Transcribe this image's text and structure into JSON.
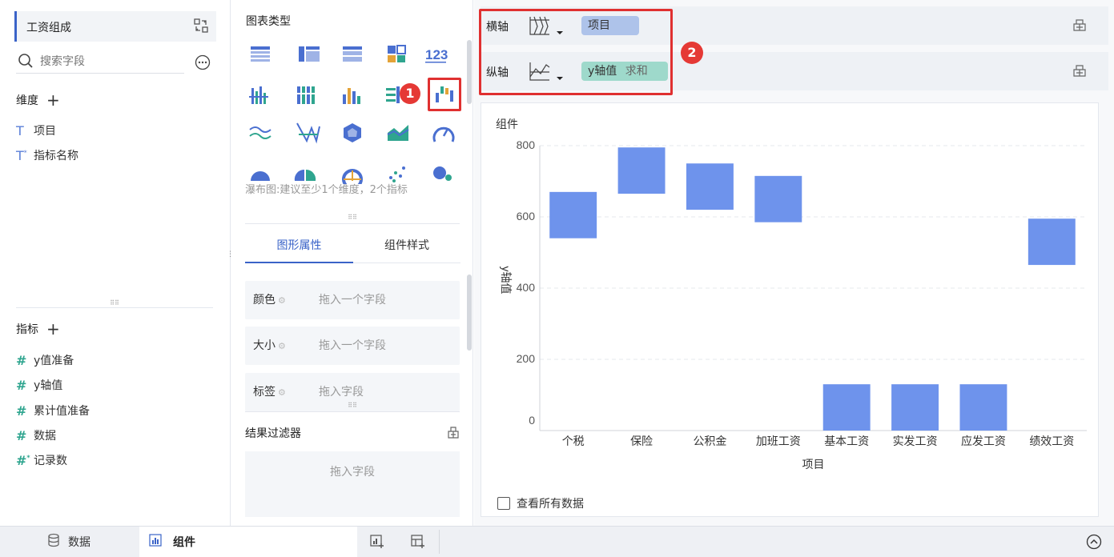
{
  "left": {
    "title": "工资组成",
    "search_placeholder": "搜索字段",
    "dimensions_label": "维度",
    "dimensions": [
      {
        "label": "项目",
        "icon": "text-field-icon"
      },
      {
        "label": "指标名称",
        "icon": "text-field-calc-icon"
      }
    ],
    "metrics_label": "指标",
    "metrics": [
      {
        "label": "y值准备",
        "icon": "hash-icon"
      },
      {
        "label": "y轴值",
        "icon": "hash-icon"
      },
      {
        "label": "累计值准备",
        "icon": "hash-icon"
      },
      {
        "label": "数据",
        "icon": "hash-icon"
      },
      {
        "label": "记录数",
        "icon": "hash-calc-icon"
      }
    ]
  },
  "middle": {
    "chart_type_label": "图表类型",
    "hint": "瀑布图:建议至少1个维度，2个指标",
    "tabs": [
      "图形属性",
      "组件样式"
    ],
    "props": [
      {
        "label": "颜色",
        "placeholder": "拖入一个字段"
      },
      {
        "label": "大小",
        "placeholder": "拖入一个字段"
      },
      {
        "label": "标签",
        "placeholder": "拖入字段"
      }
    ],
    "filter_label": "结果过滤器",
    "filter_placeholder": "拖入字段"
  },
  "axes": {
    "x_label": "横轴",
    "x_field": "项目",
    "y_label": "纵轴",
    "y_field": "y轴值",
    "y_agg": "求和"
  },
  "badges": [
    "1",
    "2"
  ],
  "chart_panel": {
    "title": "组件",
    "view_all": "查看所有数据"
  },
  "bottom": {
    "data_tab": "数据",
    "component_tab": "组件"
  },
  "colors": {
    "bar": "#6e93ec",
    "accent": "#3a63c8",
    "highlight": "#e03030"
  },
  "chart_data": {
    "type": "bar",
    "subtype": "waterfall",
    "categories": [
      "个税",
      "保险",
      "公积金",
      "加班工资",
      "基本工资",
      "实发工资",
      "应发工资",
      "绩效工资"
    ],
    "ranges": [
      [
        540,
        670
      ],
      [
        665,
        795
      ],
      [
        620,
        750
      ],
      [
        585,
        715
      ],
      [
        0,
        130
      ],
      [
        0,
        130
      ],
      [
        0,
        130
      ],
      [
        465,
        595
      ]
    ],
    "yticks": [
      0,
      200,
      400,
      600,
      800
    ],
    "ylim": [
      0,
      800
    ],
    "xlabel": "项目",
    "ylabel": "y轴值",
    "grid": true
  }
}
